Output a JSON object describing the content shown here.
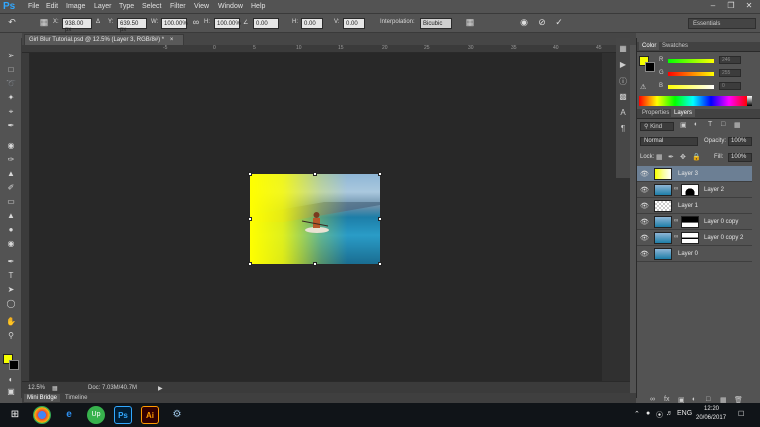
{
  "menu": {
    "logo": "Ps",
    "items": [
      "File",
      "Edit",
      "Image",
      "Layer",
      "Type",
      "Select",
      "Filter",
      "View",
      "Window",
      "Help"
    ]
  },
  "options": {
    "x_label": "X:",
    "x_value": "938.00 px",
    "y_label": "Y:",
    "y_value": "639.50 px",
    "w_label": "W:",
    "w_value": "100.00%",
    "h_label": "H:",
    "h_value": "100.00%",
    "angle_value": "0.00",
    "hskew_label": "H:",
    "hskew_value": "0.00",
    "vskew_label": "V:",
    "vskew_value": "0.00",
    "interp_label": "Interpolation:",
    "interp_value": "Bicubic",
    "workspace": "Essentials"
  },
  "document": {
    "tab_title": "Girl Blur Tutorial.psd @ 12.5% (Layer 3, RGB/8#) *",
    "ruler_top": [
      "-5",
      "0",
      "5",
      "10",
      "15",
      "20",
      "25",
      "30",
      "35",
      "40",
      "45"
    ],
    "zoom": "12.5%",
    "doc_size": "Doc: 7.03M/40.7M"
  },
  "bottom_tabs": [
    "Mini Bridge",
    "Timeline"
  ],
  "color_panel": {
    "tabs": [
      "Color",
      "Swatches"
    ],
    "r_label": "R",
    "r_value": "246",
    "g_label": "G",
    "g_value": "255",
    "b_label": "B",
    "b_value": "0",
    "colors": {
      "foreground": "#f6ff00",
      "background": "#000000"
    }
  },
  "layers_panel": {
    "tabs": [
      "Properties",
      "Layers"
    ],
    "filter": "Kind",
    "blend_mode": "Normal",
    "opacity_label": "Opacity:",
    "opacity_value": "100%",
    "lock_label": "Lock:",
    "fill_label": "Fill:",
    "fill_value": "100%",
    "layers": [
      {
        "name": "Layer 3"
      },
      {
        "name": "Layer 2"
      },
      {
        "name": "Layer 1"
      },
      {
        "name": "Layer 0 copy"
      },
      {
        "name": "Layer 0 copy 2"
      },
      {
        "name": "Layer 0"
      }
    ]
  },
  "taskbar": {
    "lang": "ENG",
    "time": "12:20",
    "date": "20/06/2017"
  }
}
